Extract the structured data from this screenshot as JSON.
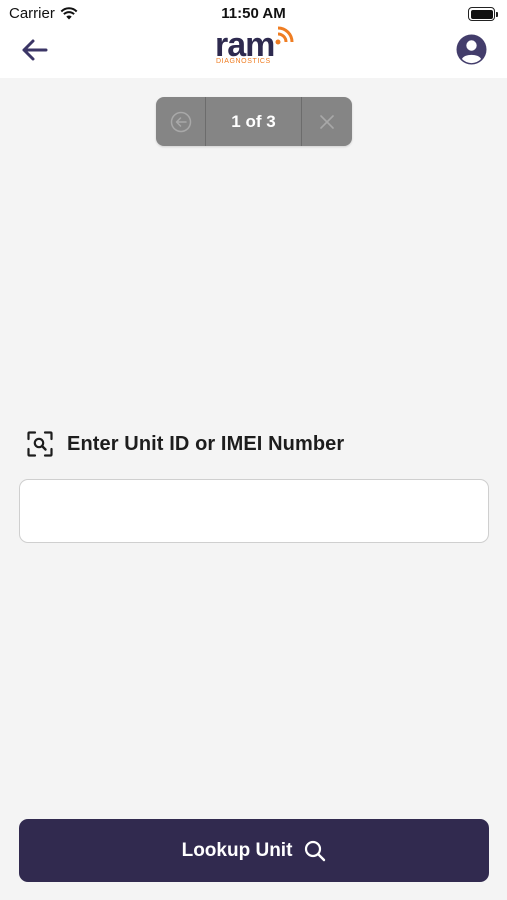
{
  "status_bar": {
    "carrier": "Carrier",
    "time": "11:50 AM"
  },
  "header": {
    "logo_text": "ram",
    "logo_subtext": "DIAGNOSTICS",
    "brand_color": "#2e2a4f",
    "accent_color": "#ef7d22",
    "back_icon": "arrow-left-icon",
    "profile_icon": "user-circle-icon"
  },
  "pager": {
    "label": "1 of 3",
    "prev_icon": "circle-arrow-left-icon",
    "close_icon": "close-icon"
  },
  "form": {
    "label": "Enter Unit ID or IMEI Number",
    "label_icon": "scan-search-icon",
    "input_value": "",
    "input_placeholder": ""
  },
  "actions": {
    "lookup_label": "Lookup Unit",
    "lookup_icon": "search-icon",
    "button_color": "#312a4f"
  }
}
